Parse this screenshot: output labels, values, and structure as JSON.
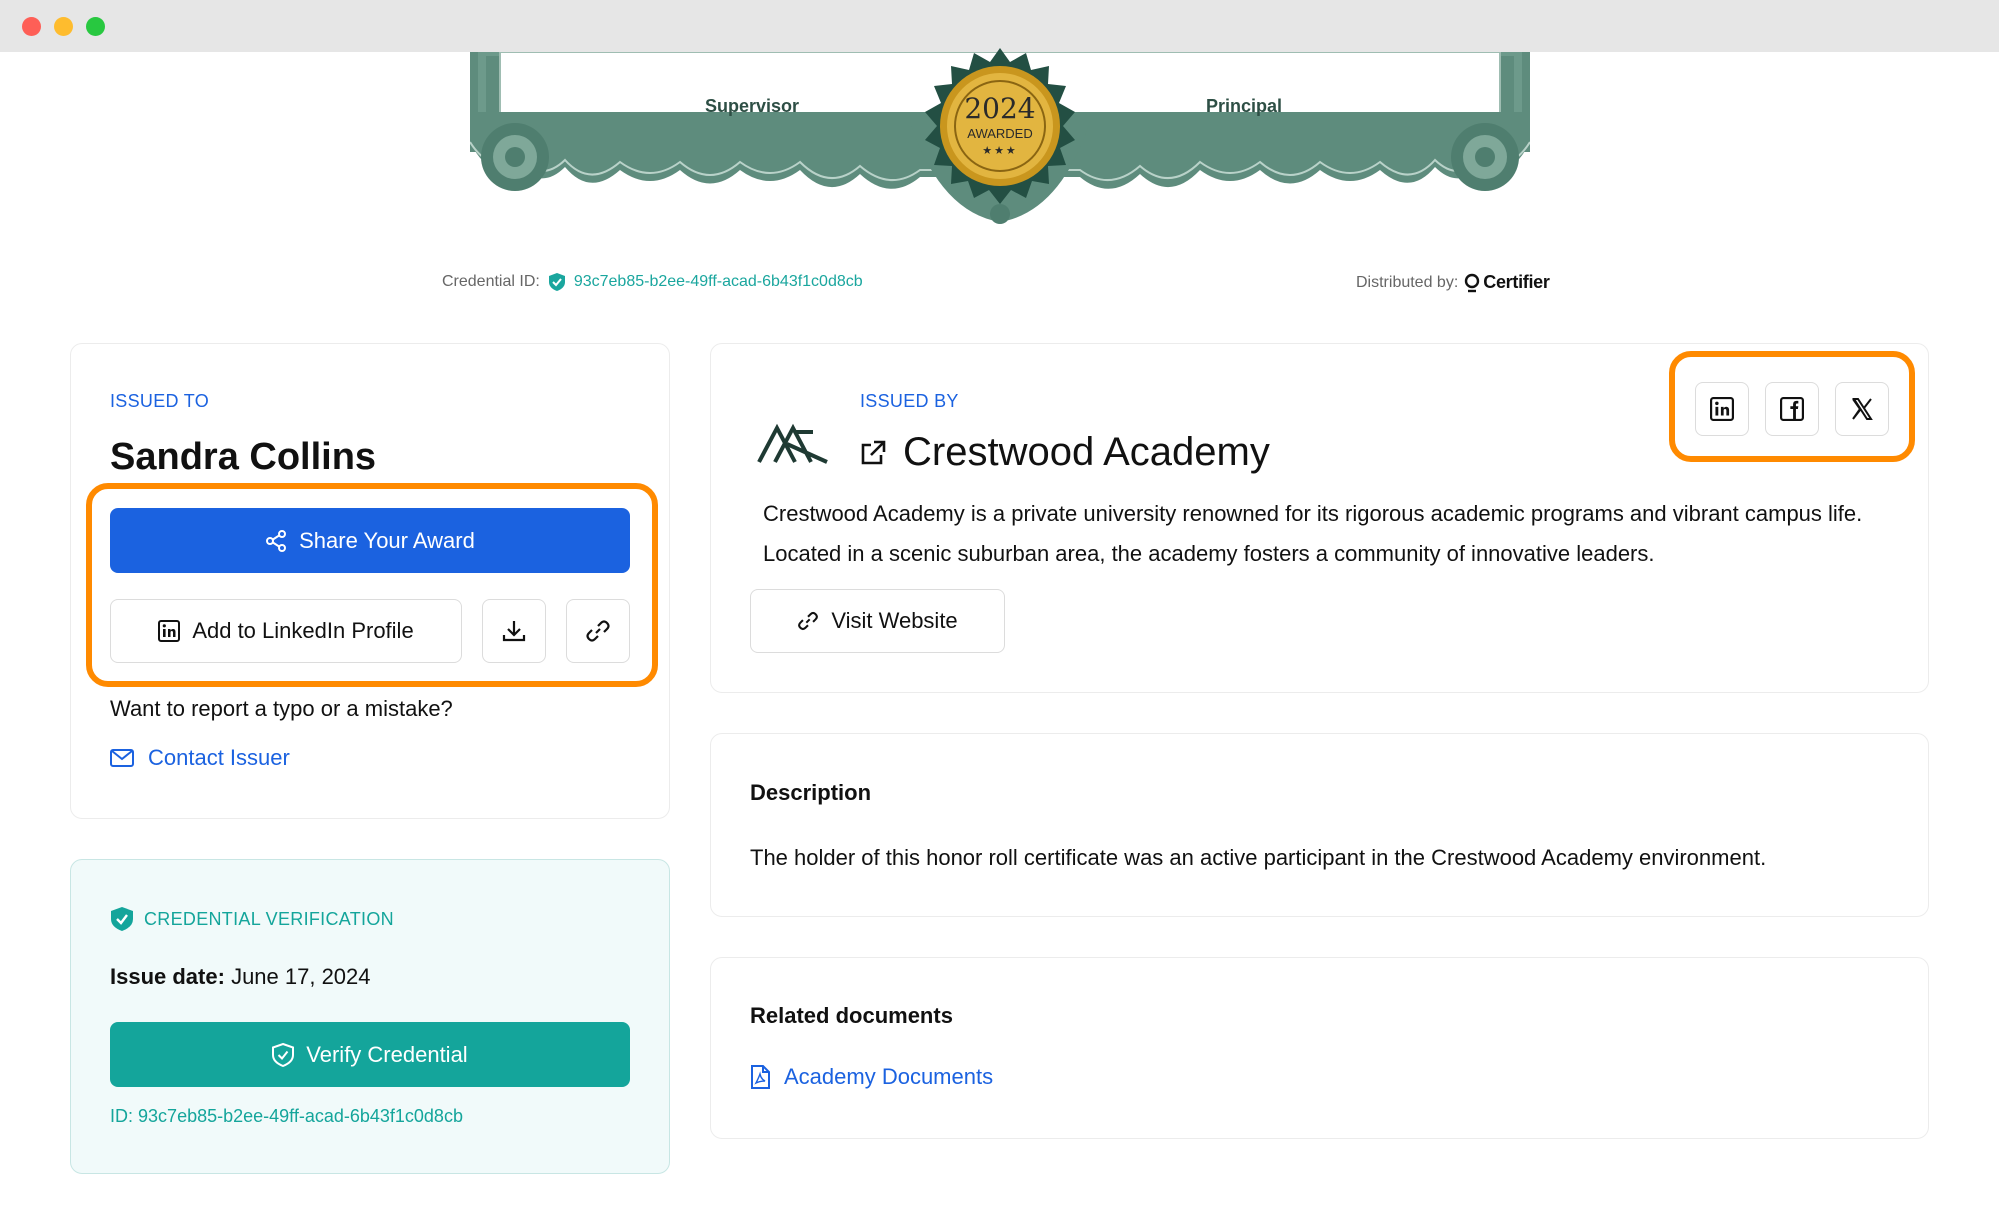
{
  "certificate": {
    "signer_left": "Supervisor",
    "signer_right": "Principal",
    "seal_year": "2024",
    "seal_text": "AWARDED",
    "seal_stars": "★★★"
  },
  "meta": {
    "credential_id_label": "Credential ID:",
    "credential_id": "93c7eb85-b2ee-49ff-acad-6b43f1c0d8cb",
    "distributed_label": "Distributed by:",
    "distributor": "Certifier"
  },
  "issued_to": {
    "eyebrow": "ISSUED TO",
    "name": "Sandra Collins",
    "share_button": "Share Your Award",
    "linkedin_button": "Add to LinkedIn Profile",
    "report_text": "Want to report a typo or a mistake?",
    "contact_link": "Contact Issuer"
  },
  "verification": {
    "title": "CREDENTIAL VERIFICATION",
    "issue_date_label": "Issue date:",
    "issue_date": "June 17, 2024",
    "verify_button": "Verify Credential",
    "id_label": "ID:",
    "id_value": "93c7eb85-b2ee-49ff-acad-6b43f1c0d8cb"
  },
  "issuer": {
    "eyebrow": "ISSUED BY",
    "name": "Crestwood Academy",
    "description": "Crestwood Academy is a private university renowned for its rigorous academic programs and vibrant campus life. Located in a scenic suburban area, the academy fosters a community of innovative leaders.",
    "visit_button": "Visit Website"
  },
  "description_card": {
    "title": "Description",
    "text": "The holder of this honor roll certificate was an active participant in the Crestwood Academy environment."
  },
  "related": {
    "title": "Related documents",
    "document_link": "Academy Documents"
  },
  "colors": {
    "primary_blue": "#1b62e0",
    "teal": "#14a59b",
    "highlight_orange": "#ff8a00"
  },
  "icons": [
    "share-icon",
    "linkedin-icon",
    "download-icon",
    "link-icon",
    "mail-icon",
    "shield-check-icon",
    "external-link-icon",
    "facebook-icon",
    "x-icon",
    "pdf-icon"
  ]
}
